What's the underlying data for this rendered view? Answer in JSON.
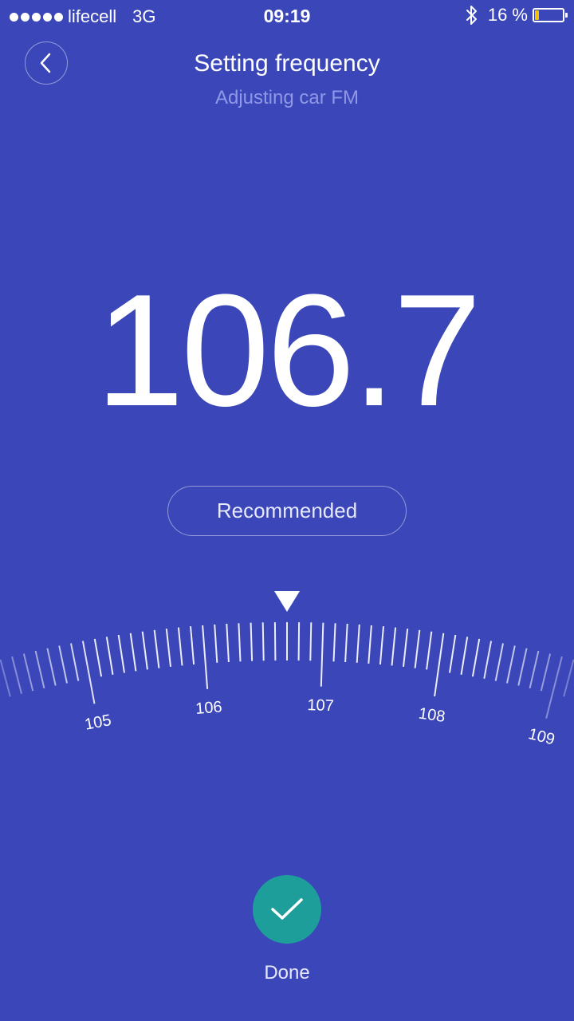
{
  "status_bar": {
    "carrier": "lifecell",
    "network": "3G",
    "time": "09:19",
    "battery_text": "16 %",
    "battery_level": 0.16,
    "battery_color": "#f2c200"
  },
  "header": {
    "back_icon": "chevron-left-icon",
    "title": "Setting frequency",
    "subtitle": "Adjusting car FM"
  },
  "tuner": {
    "frequency": "106.7",
    "recommended_label": "Recommended",
    "dial": {
      "selected": 106.7,
      "major_labels": [
        "105",
        "106",
        "107",
        "108",
        "109"
      ]
    }
  },
  "footer": {
    "done_icon": "check-icon",
    "done_label": "Done",
    "done_color": "#1e9e9a"
  },
  "theme": {
    "background": "#3b47b9",
    "muted_text": "#8f98e6"
  }
}
